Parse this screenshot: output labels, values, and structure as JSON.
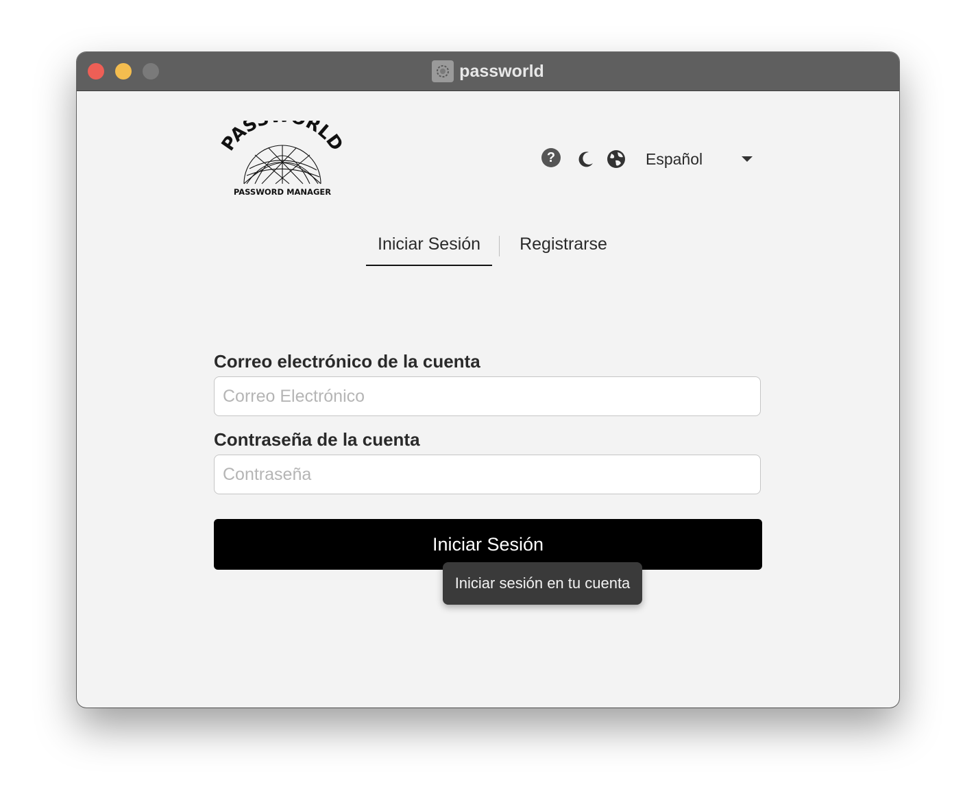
{
  "window": {
    "title": "passworld",
    "app_icon": "passworld-app-icon",
    "controls": [
      "close",
      "minimize",
      "maximize"
    ]
  },
  "logo": {
    "arc_text": "PASSWORLD",
    "subtitle": "PASSWORD MANAGER"
  },
  "toolbar": {
    "help_icon": "question-mark",
    "help_glyph": "?",
    "theme_icon": "moon",
    "language_icon": "globe",
    "language_selected": "Español"
  },
  "tabs": [
    {
      "label": "Iniciar Sesión",
      "active": true
    },
    {
      "label": "Registrarse",
      "active": false
    }
  ],
  "form": {
    "email_label": "Correo electrónico de la cuenta",
    "email_value": "",
    "email_placeholder": "Correo Electrónico",
    "password_label": "Contraseña de la cuenta",
    "password_value": "",
    "password_placeholder": "Contraseña",
    "submit_label": "Iniciar Sesión",
    "submit_tooltip": "Iniciar sesión en tu cuenta"
  },
  "colors": {
    "titlebar": "#5f5f5f",
    "background": "#f3f3f3",
    "button": "#000000",
    "close": "#ee5f56",
    "minimize": "#f4bd4f"
  }
}
